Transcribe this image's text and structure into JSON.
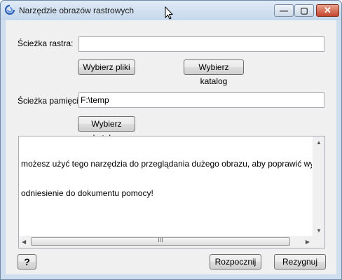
{
  "window": {
    "title": "Narzędzie obrazów rastrowych",
    "min_glyph": "—",
    "max_glyph": "▢",
    "close_glyph": "✕"
  },
  "raster": {
    "label": "Ścieżka rastra:",
    "value": "",
    "choose_files": "Wybierz pliki",
    "choose_folder": "Wybierz katalog"
  },
  "cache": {
    "label": "Ścieżka pamięci:",
    "value": "F:\\temp",
    "choose_folder": "Wybierz katalog"
  },
  "info": {
    "line1": "możesz użyć tego narzędzia do przeglądania dużego obrazu, aby poprawić wydajność ob",
    "line2": "odniesienie do dokumentu pomocy!"
  },
  "scrollbar": {
    "up": "▲",
    "down": "▼",
    "left": "◀",
    "right": "▶",
    "grip": "III"
  },
  "footer": {
    "help": "?",
    "start": "Rozpocznij",
    "cancel": "Rezygnuj"
  }
}
